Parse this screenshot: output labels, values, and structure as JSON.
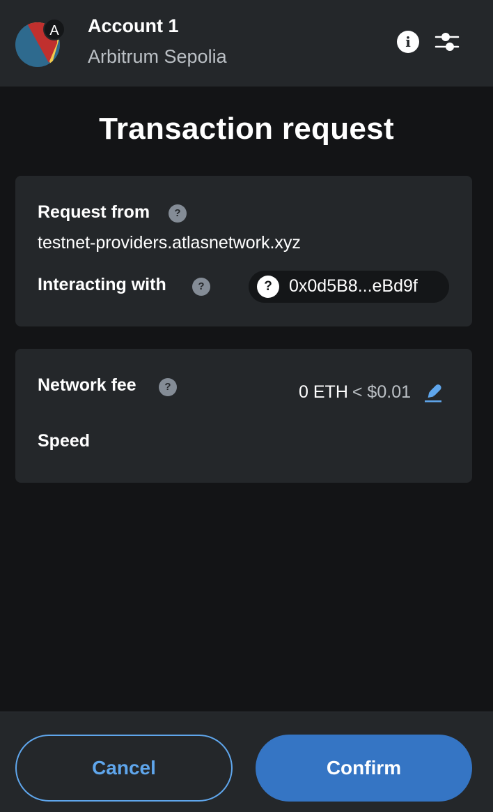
{
  "header": {
    "account_name": "Account 1",
    "network_name": "Arbitrum Sepolia",
    "avatar_badge_letter": "A",
    "info_icon": "info-icon",
    "settings_icon": "sliders-icon",
    "avatar_colors": [
      "#2e6a8e",
      "#c0302e",
      "#f2c94c"
    ]
  },
  "page": {
    "title": "Transaction request"
  },
  "request_card": {
    "request_from_label": "Request from",
    "request_from_value": "testnet-providers.atlasnetwork.xyz",
    "interacting_with_label": "Interacting with",
    "interacting_with_address": "0x0d5B8...eBd9f",
    "help_glyph": "?"
  },
  "fee_card": {
    "network_fee_label": "Network fee",
    "fee_eth": "0 ETH",
    "fee_fiat": "< $0.01",
    "speed_label": "Speed",
    "edit_icon": "pencil-icon"
  },
  "footer": {
    "cancel_label": "Cancel",
    "confirm_label": "Confirm"
  },
  "colors": {
    "accent": "#3575c4",
    "accent_light": "#5fa6ec",
    "background": "#131416",
    "surface": "#24272a",
    "muted_text": "#bbc0c5",
    "help_icon": "#848c96"
  }
}
